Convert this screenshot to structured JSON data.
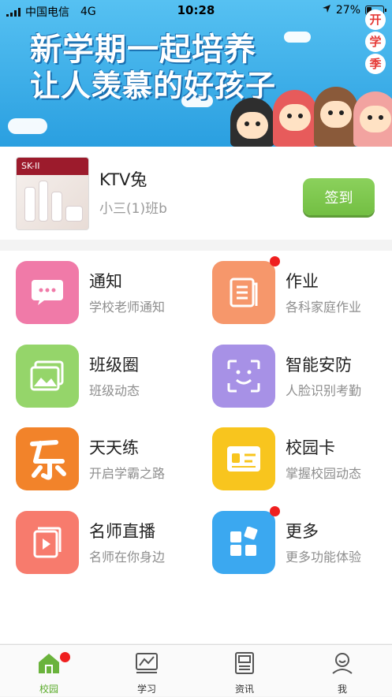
{
  "status_bar": {
    "carrier": "中国电信",
    "network": "4G",
    "time": "10:28",
    "battery": "27%"
  },
  "banner": {
    "line1": "新学期一起培养",
    "line2": "让人羡慕的好孩子",
    "badge": [
      "开",
      "学",
      "季"
    ]
  },
  "profile": {
    "avatar_label": "SK-II",
    "name": "KTV兔",
    "class": "小三(1)班b",
    "checkin_label": "签到"
  },
  "features": [
    {
      "title": "通知",
      "subtitle": "学校老师通知",
      "color": "#f07aa8",
      "icon": "chat-icon",
      "has_dot": false
    },
    {
      "title": "作业",
      "subtitle": "各科家庭作业",
      "color": "#f6976b",
      "icon": "document-icon",
      "has_dot": true
    },
    {
      "title": "班级圈",
      "subtitle": "班级动态",
      "color": "#95d56a",
      "icon": "gallery-icon",
      "has_dot": false
    },
    {
      "title": "智能安防",
      "subtitle": "人脸识别考勤",
      "color": "#a791e6",
      "icon": "face-scan-icon",
      "has_dot": false
    },
    {
      "title": "天天练",
      "subtitle": "开启学霸之路",
      "color": "#f2832a",
      "icon": "le-icon",
      "has_dot": false
    },
    {
      "title": "校园卡",
      "subtitle": "掌握校园动态",
      "color": "#f8c51e",
      "icon": "card-icon",
      "has_dot": false
    },
    {
      "title": "名师直播",
      "subtitle": "名师在你身边",
      "color": "#f77b6d",
      "icon": "video-icon",
      "has_dot": false
    },
    {
      "title": "更多",
      "subtitle": "更多功能体验",
      "color": "#3ba8f0",
      "icon": "more-apps-icon",
      "has_dot": true
    }
  ],
  "tabs": [
    {
      "label": "校园",
      "icon": "home-icon",
      "active": true,
      "has_dot": true
    },
    {
      "label": "学习",
      "icon": "chart-icon",
      "active": false,
      "has_dot": false
    },
    {
      "label": "资讯",
      "icon": "news-icon",
      "active": false,
      "has_dot": false
    },
    {
      "label": "我",
      "icon": "profile-icon",
      "active": false,
      "has_dot": false
    }
  ],
  "colors": {
    "accent_green": "#73bf43",
    "badge_red": "#ef1f1f"
  }
}
